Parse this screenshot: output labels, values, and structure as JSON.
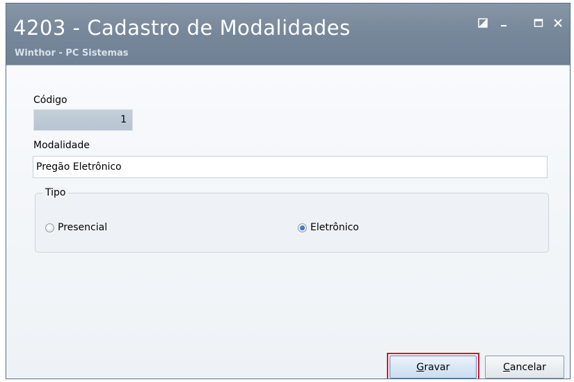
{
  "window": {
    "title": "4203 - Cadastro de Modalidades",
    "subtitle": "Winthor - PC Sistemas",
    "controls": [
      "restore-icon",
      "minimize-icon",
      "maximize-icon",
      "close-icon"
    ]
  },
  "form": {
    "codigo_label": "Código",
    "codigo_value": "1",
    "modalidade_label": "Modalidade",
    "modalidade_value": "Pregão Eletrônico",
    "tipo_group_label": "Tipo",
    "tipo_options": [
      {
        "label": "Presencial",
        "selected": false
      },
      {
        "label": "Eletrônico",
        "selected": true
      }
    ]
  },
  "buttons": {
    "gravar": {
      "first": "G",
      "rest": "ravar"
    },
    "cancelar": {
      "first": "C",
      "rest": "ancelar"
    }
  },
  "colors": {
    "titlebar": "#7a8b9d",
    "highlight": "#e0102a"
  }
}
